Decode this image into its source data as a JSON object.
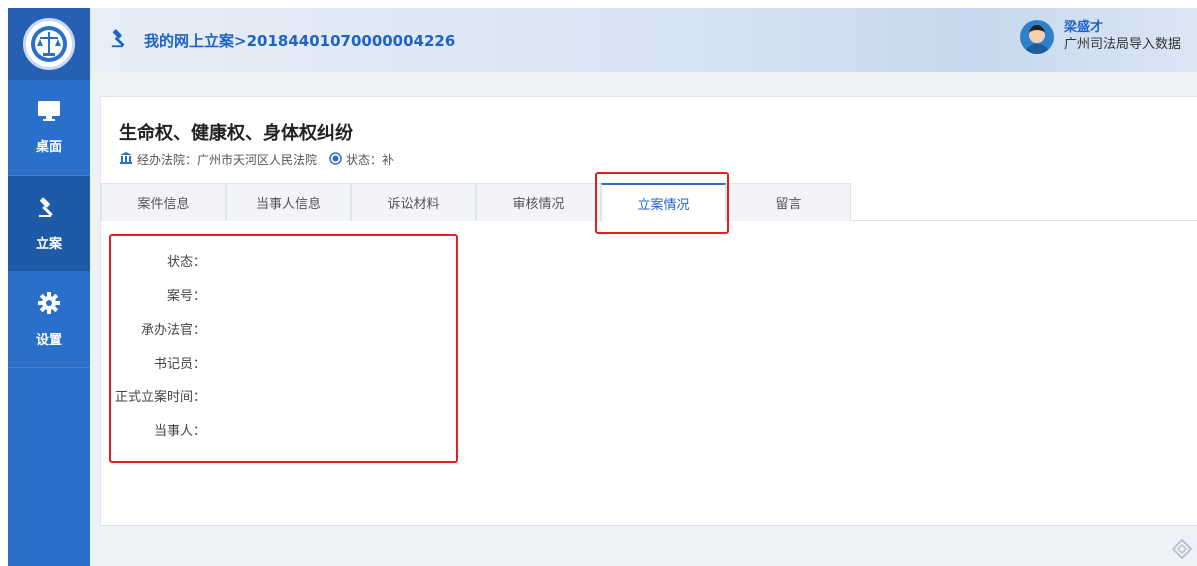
{
  "sidebar": {
    "items": [
      {
        "label": "桌面",
        "icon": "monitor-icon"
      },
      {
        "label": "立案",
        "icon": "gavel-icon"
      },
      {
        "label": "设置",
        "icon": "gear-icon"
      }
    ]
  },
  "header": {
    "breadcrumb": "我的网上立案>20184401070000004226",
    "user_name": "梁盛才",
    "user_org": "广州司法局导入数据"
  },
  "case": {
    "title": "生命权、健康权、身体权纠纷",
    "court_label": "经办法院：广州市天河区人民法院",
    "status_label": "状态：补"
  },
  "tabs": [
    "案件信息",
    "当事人信息",
    "诉讼材料",
    "审核情况",
    "立案情况",
    "留言"
  ],
  "active_tab": "立案情况",
  "fields": [
    "状态：",
    "案号：",
    "承办法官：",
    "书记员：",
    "正式立案时间：",
    "当事人："
  ],
  "colors": {
    "primary": "#2a6fc9",
    "highlight": "#e02020"
  }
}
